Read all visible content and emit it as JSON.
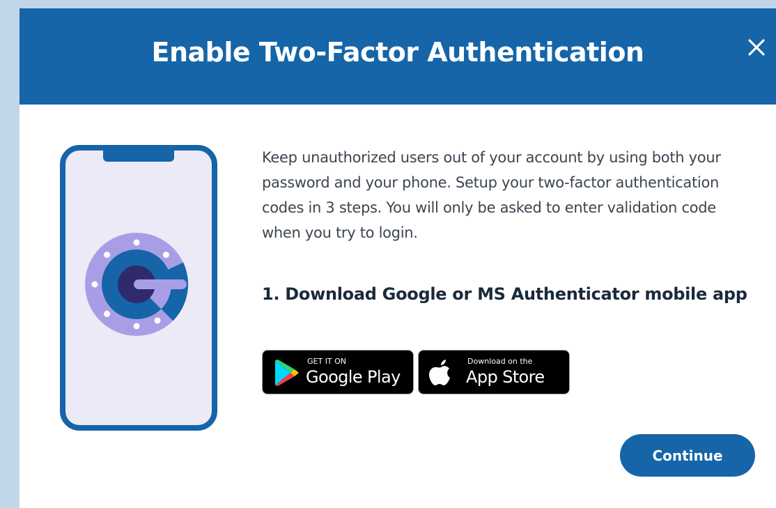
{
  "modal": {
    "title": "Enable Two-Factor Authentication",
    "close_icon": "close-icon",
    "illustration_icon": "authenticator-phone-icon",
    "intro": "Keep unauthorized users out of your account by using both your password and your phone. Setup your two-factor authentication codes in 3 steps. You will only be asked to enter validation code when you try to login.",
    "step1_heading": "1. Download Google or MS Authenticator mobile app",
    "google_play": {
      "small_text": "GET IT ON",
      "big_text": "Google Play",
      "icon": "google-play-icon"
    },
    "app_store": {
      "small_text": "Download on the",
      "big_text": "App Store",
      "icon": "apple-icon"
    },
    "continue_label": "Continue"
  },
  "colors": {
    "header_blue": "#1565a8",
    "backdrop": "#c2d6ea",
    "phone_screen": "#eceaf7",
    "authenticator_purple": "#a99ee6",
    "authenticator_dark": "#2f2a6b"
  }
}
